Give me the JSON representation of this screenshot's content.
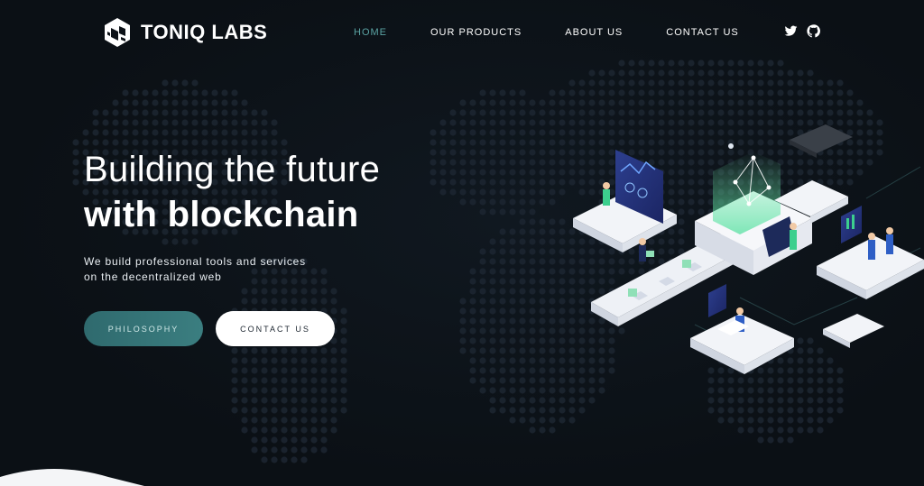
{
  "brand": {
    "name": "TONIQ LABS",
    "logo_icon": "toniq-cube-logo-icon"
  },
  "nav": {
    "items": [
      {
        "label": "HOME",
        "active": true
      },
      {
        "label": "OUR PRODUCTS",
        "active": false
      },
      {
        "label": "ABOUT US",
        "active": false
      },
      {
        "label": "CONTACT US",
        "active": false
      }
    ],
    "social": [
      {
        "icon": "twitter-icon"
      },
      {
        "icon": "github-icon"
      }
    ]
  },
  "hero": {
    "headline_line1": "Building the future",
    "headline_line2": "with blockchain",
    "subtext_line1": "We build professional tools and services",
    "subtext_line2": "on the decentralized web",
    "primary_button": "PHILOSOPHY",
    "secondary_button": "CONTACT US",
    "illustration": "isometric-blockchain-workflow-illustration"
  },
  "colors": {
    "background": "#0c1117",
    "accent": "#3b7e80",
    "nav_active": "#5aa3a3",
    "text": "#ffffff"
  }
}
